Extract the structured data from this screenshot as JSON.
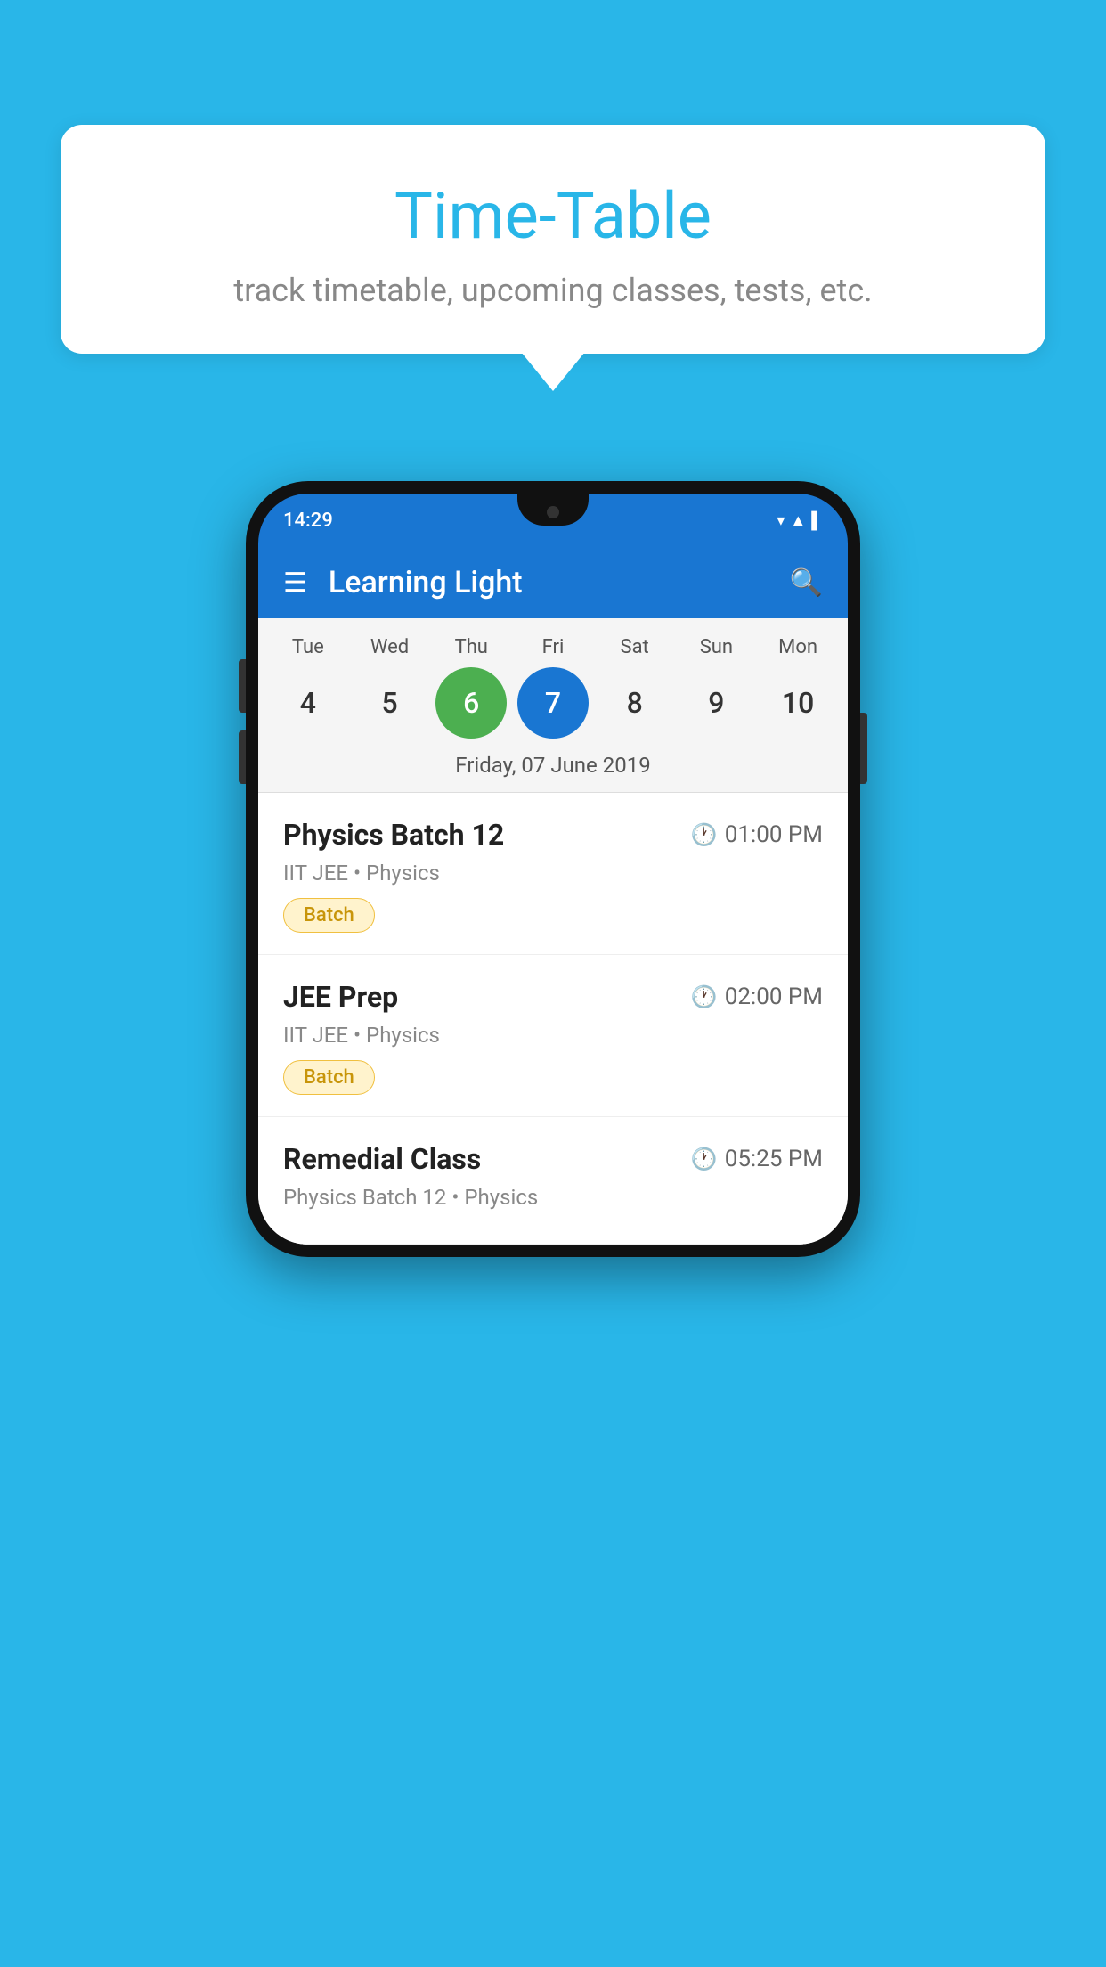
{
  "background": {
    "color": "#29b6e8"
  },
  "speech_bubble": {
    "title": "Time-Table",
    "subtitle": "track timetable, upcoming classes, tests, etc."
  },
  "app_bar": {
    "title": "Learning Light"
  },
  "status_bar": {
    "time": "14:29"
  },
  "calendar": {
    "selected_date_label": "Friday, 07 June 2019",
    "days": [
      {
        "name": "Tue",
        "number": "4",
        "state": "normal"
      },
      {
        "name": "Wed",
        "number": "5",
        "state": "normal"
      },
      {
        "name": "Thu",
        "number": "6",
        "state": "today"
      },
      {
        "name": "Fri",
        "number": "7",
        "state": "selected"
      },
      {
        "name": "Sat",
        "number": "8",
        "state": "normal"
      },
      {
        "name": "Sun",
        "number": "9",
        "state": "normal"
      },
      {
        "name": "Mon",
        "number": "10",
        "state": "normal"
      }
    ]
  },
  "schedule": [
    {
      "title": "Physics Batch 12",
      "time": "01:00 PM",
      "subtitle": "IIT JEE • Physics",
      "badge": "Batch"
    },
    {
      "title": "JEE Prep",
      "time": "02:00 PM",
      "subtitle": "IIT JEE • Physics",
      "badge": "Batch"
    },
    {
      "title": "Remedial Class",
      "time": "05:25 PM",
      "subtitle": "Physics Batch 12 • Physics",
      "badge": ""
    }
  ]
}
